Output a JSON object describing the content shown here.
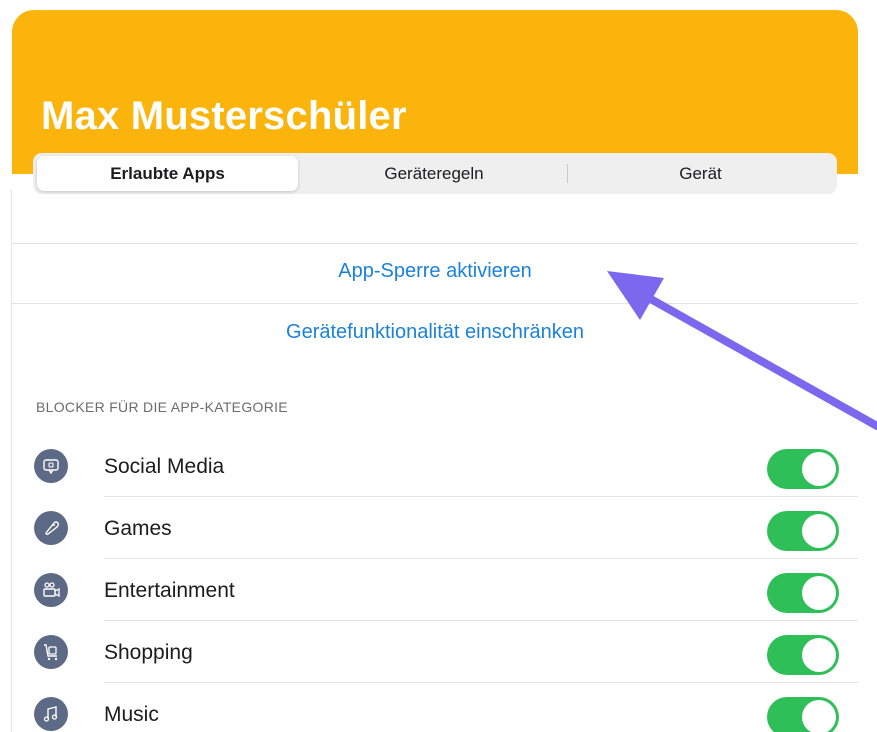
{
  "header": {
    "title": "Max Musterschüler",
    "background_color": "#fbb40b"
  },
  "tabs": [
    {
      "label": "Erlaubte Apps",
      "selected": true
    },
    {
      "label": "Geräteregeln",
      "selected": false
    },
    {
      "label": "Gerät",
      "selected": false
    }
  ],
  "actions": {
    "app_lock": "App-Sperre aktivieren",
    "restrict_device": "Gerätefunktionalität einschränken",
    "link_color": "#1a82db"
  },
  "category_section": {
    "header": "BLOCKER FÜR DIE APP-KATEGORIE",
    "items": [
      {
        "label": "Social Media",
        "icon": "chat-bubble-icon",
        "enabled": true
      },
      {
        "label": "Games",
        "icon": "gamepad-icon",
        "enabled": true
      },
      {
        "label": "Entertainment",
        "icon": "video-camera-icon",
        "enabled": true
      },
      {
        "label": "Shopping",
        "icon": "shopping-cart-icon",
        "enabled": true
      },
      {
        "label": "Music",
        "icon": "music-note-icon",
        "enabled": true
      }
    ],
    "toggle_on_color": "#2fbf58"
  },
  "annotation": {
    "arrow_color": "#7b68ee",
    "points_to": "App-Sperre aktivieren"
  }
}
